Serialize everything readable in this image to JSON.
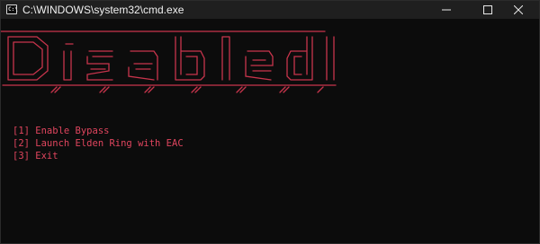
{
  "window": {
    "title": "C:\\WINDOWS\\system32\\cmd.exe",
    "icon": "cmd-icon",
    "controls": [
      "minimize-icon",
      "maximize-icon",
      "close-icon"
    ]
  },
  "console": {
    "background": "#0c0c0c",
    "text_color": "#e0455e",
    "banner_word": "Disabled",
    "menu": [
      {
        "label": "[1] Enable Bypass"
      },
      {
        "label": "[2] Launch Elden Ring with EAC"
      },
      {
        "label": "[3] Exit"
      }
    ]
  }
}
